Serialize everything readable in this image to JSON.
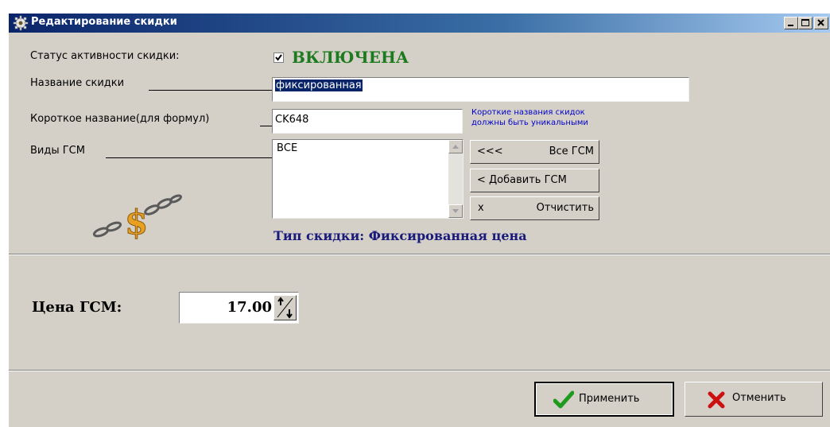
{
  "window": {
    "title": "Редактирование скидки"
  },
  "form": {
    "status_label": "Статус активности скидки:",
    "status_checked": true,
    "status_text": "ВКЛЮЧЕНА",
    "status_color": "#1e7a1e",
    "name_label": "Название скидки",
    "name_value": "фиксированная",
    "short_label": "Короткое название(для формул)",
    "short_value": "CK648",
    "short_hint_line1": "Короткие названия скидок",
    "short_hint_line2": "должны быть уникальными",
    "hint_color": "#0000cc",
    "fuel_label": "Виды ГСМ",
    "fuel_list": [
      "ВСЕ"
    ],
    "all_fuel_arrows": "<<<",
    "all_fuel_text": "Все ГСМ",
    "add_fuel_text": "< Добавить ГСМ",
    "clear_x": "x",
    "clear_text": "Отчистить",
    "discount_type": "Тип скидки: Фиксированная цена",
    "discount_type_color": "#1a1a7a",
    "logo_icon": "chain-dollar-icon"
  },
  "price": {
    "label": "Цена ГСМ:",
    "value": "17.00"
  },
  "footer": {
    "apply_label": "Применить",
    "cancel_label": "Отменить"
  }
}
